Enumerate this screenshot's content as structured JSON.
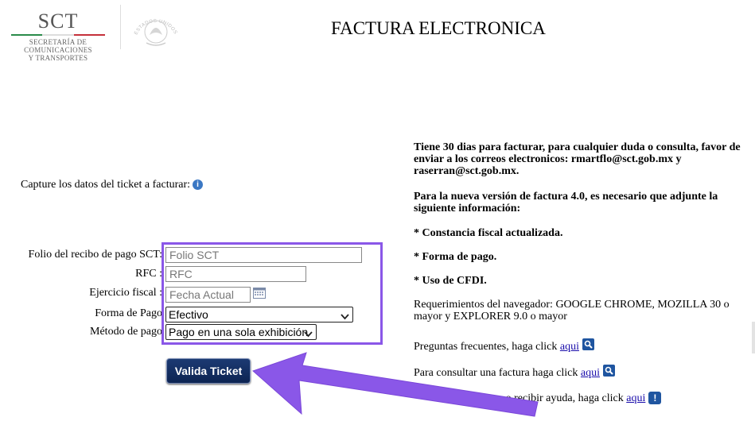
{
  "header": {
    "logo_text": "SCT",
    "logo_subtitle_1": "SECRETARÍA DE",
    "logo_subtitle_2": "COMUNICACIONES",
    "logo_subtitle_3": "Y TRANSPORTES",
    "seal_text": "ESTADOS UNIDOS MEXICANOS",
    "title": "FACTURA ELECTRONICA"
  },
  "form": {
    "prompt": "Capture los datos del ticket a facturar:",
    "folio_label": "Folio del recibo de pago SCT:",
    "folio_placeholder": "Folio SCT",
    "rfc_label": "RFC :",
    "rfc_placeholder": "RFC",
    "ejercicio_label": "Ejercicio fiscal :",
    "ejercicio_placeholder": "Fecha Actual",
    "forma_label": "Forma de Pago",
    "forma_value": "Efectivo",
    "metodo_label": "Método de pago",
    "metodo_value": "Pago en una sola exhibición",
    "submit_label": "Valida Ticket"
  },
  "info": {
    "p1": "Tiene 30 dias para facturar, para cualquier duda o consulta, favor de enviar a los correos electronicos: rmartflo@sct.gob.mx y raserran@sct.gob.mx.",
    "p2": "Para la nueva versión de factura 4.0, es necesario que adjunte la siguiente información:",
    "item1": "* Constancia fiscal actualizada.",
    "item2": "* Forma de pago.",
    "item3": "* Uso de CFDI.",
    "browser_req": "Requerimientos del navegador: GOOGLE CHROME, MOZILLA 30 o mayor y EXPLORER 9.0 o mayor",
    "faq_text": "Preguntas frecuentes, haga click",
    "faq_link": "aqui",
    "consult_text": "Para consultar una factura haga click",
    "consult_link": "aqui",
    "help_text": "los facturas o recibir ayuda, haga click",
    "help_link": "aqui"
  },
  "colors": {
    "highlight": "#8a57e8",
    "button": "#14306a",
    "link": "#1a0dab"
  }
}
